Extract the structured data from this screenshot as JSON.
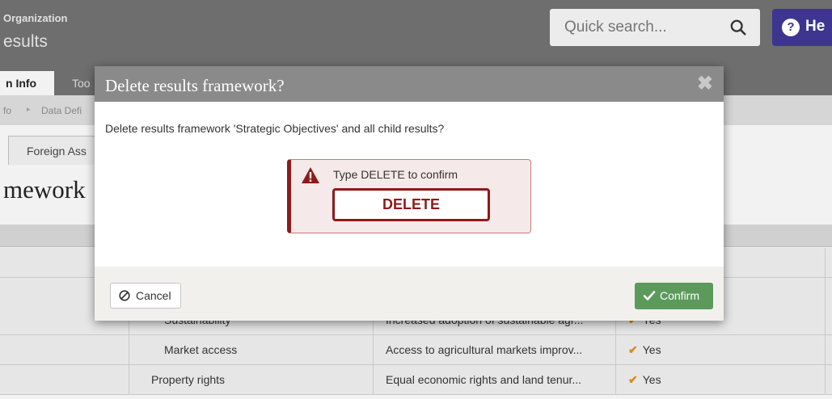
{
  "header": {
    "org_label": "Organization",
    "page_label": "esults",
    "search_placeholder": "Quick search...",
    "help_label": "He"
  },
  "tabs": {
    "active": "n Info",
    "inactive": "Too"
  },
  "breadcrumb": {
    "item1": "fo",
    "separator": "▸",
    "item2": "Data Defi"
  },
  "subtab_label": "Foreign Ass",
  "framework_title": "mework",
  "table": {
    "rows": [
      {
        "c1": "",
        "c2": "",
        "c3": "",
        "c4": ""
      },
      {
        "c1": "",
        "c2": "",
        "c3": "",
        "c4": ""
      },
      {
        "c1": "",
        "c2": "Sustainability",
        "c3": "Increased adoption of sustainable agr...",
        "c4": "Yes"
      },
      {
        "c1": "",
        "c2": "Market access",
        "c3": "Access to agricultural markets improv...",
        "c4": "Yes"
      },
      {
        "c1": "",
        "c2": "Property rights",
        "c3": "Equal economic rights and land tenur...",
        "c4": "Yes"
      }
    ]
  },
  "modal": {
    "title": "Delete results framework?",
    "close_glyph": "✖",
    "message": "Delete results framework 'Strategic Objectives' and all child results?",
    "confirm_label": "Type DELETE to confirm",
    "confirm_input_value": "DELETE",
    "cancel_label": "Cancel",
    "confirm_button_label": "Confirm"
  },
  "colors": {
    "danger": "#8e1a1a",
    "confirm_green": "#5c9a5c",
    "help_purple": "#3d3590",
    "check_orange": "#d98a1a"
  }
}
